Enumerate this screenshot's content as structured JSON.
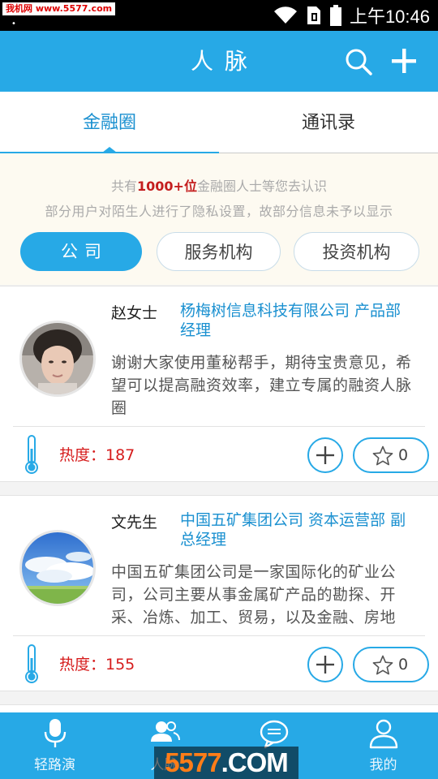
{
  "status_bar": {
    "watermark": "我机网 www.5577.com",
    "time": "上午10:46"
  },
  "app_bar": {
    "title": "人脉"
  },
  "tabs": [
    {
      "label": "金融圈",
      "active": true
    },
    {
      "label": "通讯录",
      "active": false
    }
  ],
  "info": {
    "line1_prefix": "共有",
    "line1_highlight": "1000+位",
    "line1_suffix": "金融圈人士等您去认识",
    "line2": "部分用户对陌生人进行了隐私设置，故部分信息未予以显示"
  },
  "filters": [
    {
      "label": "公司",
      "selected": true
    },
    {
      "label": "服务机构",
      "selected": false
    },
    {
      "label": "投资机构",
      "selected": false
    }
  ],
  "cards": [
    {
      "name": "赵女士",
      "company": "杨梅树信息科技有限公司 产品部 经理",
      "description": "谢谢大家使用董秘帮手，期待宝贵意见，希望可以提高融资效率，建立专属的融资人脉圈",
      "heat": "热度：187",
      "likes": "0"
    },
    {
      "name": "文先生",
      "company": "中国五矿集团公司 资本运营部 副总经理",
      "description": "中国五矿集团公司是一家国际化的矿业公司，公司主要从事金属矿产品的勘探、开采、冶炼、加工、贸易，以及金融、房地",
      "heat": "热度：155",
      "likes": "0"
    }
  ],
  "bottom_nav": [
    {
      "label": "轻路演",
      "icon": "microphone-icon"
    },
    {
      "label": "人脉",
      "icon": "contacts-icon"
    },
    {
      "label": "",
      "icon": "chat-icon"
    },
    {
      "label": "我的",
      "icon": "person-icon"
    }
  ],
  "watermark": {
    "text_num": "5577",
    "text_suffix": ".COM"
  },
  "colors": {
    "accent": "#27a9e6",
    "heat": "#d61c1c",
    "link": "#1a90d0"
  }
}
